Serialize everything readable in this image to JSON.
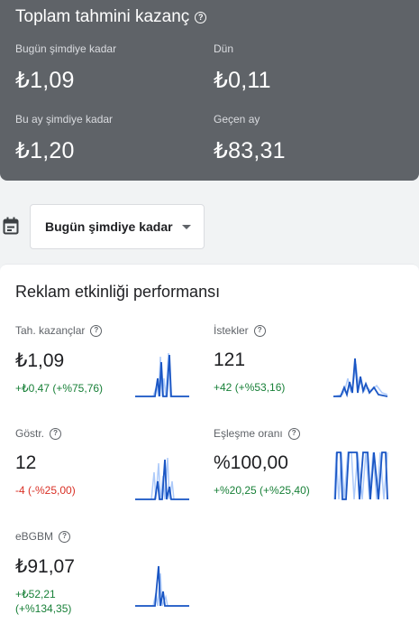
{
  "earnings": {
    "title": "Toplam tahmini kazanç",
    "help_icon": "help-circle-icon",
    "today_label": "Bugün şimdiye kadar",
    "today_value": "₺1,09",
    "yesterday_label": "Dün",
    "yesterday_value": "₺0,11",
    "month_label": "Bu ay şimdiye kadar",
    "month_value": "₺1,20",
    "last_month_label": "Geçen ay",
    "last_month_value": "₺83,31"
  },
  "date_filter": {
    "icon": "calendar-icon",
    "selected": "Bugün şimdiye kadar"
  },
  "performance": {
    "title": "Reklam etkinliği performansı",
    "metrics": [
      {
        "label": "Tah. kazançlar",
        "value": "₺1,09",
        "change": "+₺0,47 (+%75,76)",
        "trend": "positive"
      },
      {
        "label": "İstekler",
        "value": "121",
        "change": "+42 (+%53,16)",
        "trend": "positive"
      },
      {
        "label": "Göstr.",
        "value": "12",
        "change": "-4 (-%25,00)",
        "trend": "negative"
      },
      {
        "label": "Eşleşme oranı",
        "value": "%100,00",
        "change": "+%20,25 (+%25,40)",
        "trend": "positive"
      },
      {
        "label": "eBGBM",
        "value": "₺91,07",
        "change_line1": "+₺52,21",
        "change_line2": "(+%134,35)",
        "trend": "positive"
      }
    ]
  },
  "colors": {
    "header_bg": "#5f6368",
    "positive": "#188038",
    "negative": "#d93025",
    "spark_current": "#1a56c4",
    "spark_previous": "#aecbfa"
  }
}
